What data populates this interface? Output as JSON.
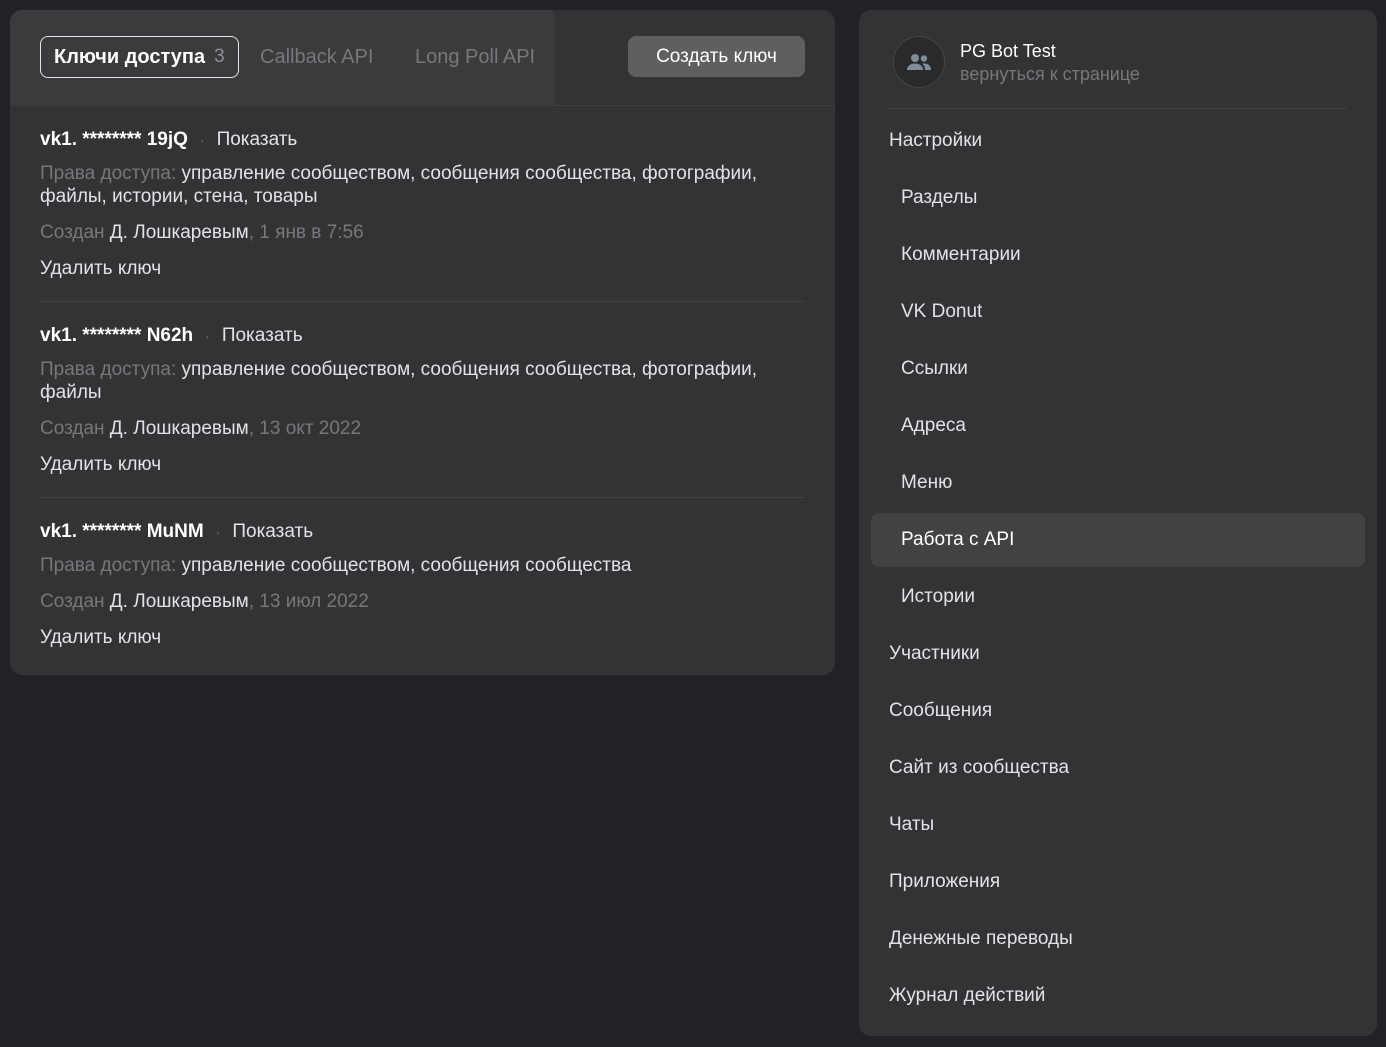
{
  "tabs": [
    {
      "label": "Ключи доступа",
      "count": "3"
    },
    {
      "label": "Callback API"
    },
    {
      "label": "Long Poll API"
    }
  ],
  "create_button": "Создать ключ",
  "keys": [
    {
      "name": "vk1. ******** 19jQ",
      "show": "Показать",
      "rights_label": "Права доступа:",
      "rights": "управление сообществом, сообщения сообщества, фотографии, файлы, истории, стена, товары",
      "created_label": "Создан",
      "author": "Д. Лошкаревым",
      "date": ", 1 янв в 7:56",
      "delete": "Удалить ключ"
    },
    {
      "name": "vk1. ******** N62h",
      "show": "Показать",
      "rights_label": "Права доступа:",
      "rights": "управление сообществом, сообщения сообщества, фотографии, файлы",
      "created_label": "Создан",
      "author": "Д. Лошкаревым",
      "date": ", 13 окт 2022",
      "delete": "Удалить ключ"
    },
    {
      "name": "vk1. ******** MuNM",
      "show": "Показать",
      "rights_label": "Права доступа:",
      "rights": "управление сообществом, сообщения сообщества",
      "created_label": "Создан",
      "author": "Д. Лошкаревым",
      "date": ", 13 июл 2022",
      "delete": "Удалить ключ"
    }
  ],
  "sidebar": {
    "group_name": "PG Bot Test",
    "back_link": "вернуться к странице",
    "avatar_icon": "users-icon",
    "items": [
      {
        "label": "Настройки",
        "sub": false
      },
      {
        "label": "Разделы",
        "sub": true
      },
      {
        "label": "Комментарии",
        "sub": true
      },
      {
        "label": "VK Donut",
        "sub": true
      },
      {
        "label": "Ссылки",
        "sub": true
      },
      {
        "label": "Адреса",
        "sub": true
      },
      {
        "label": "Меню",
        "sub": true
      },
      {
        "label": "Работа с API",
        "sub": true,
        "active": true
      },
      {
        "label": "Истории",
        "sub": true
      },
      {
        "label": "Участники",
        "sub": false
      },
      {
        "label": "Сообщения",
        "sub": false
      },
      {
        "label": "Сайт из сообщества",
        "sub": false
      },
      {
        "label": "Чаты",
        "sub": false
      },
      {
        "label": "Приложения",
        "sub": false
      },
      {
        "label": "Денежные переводы",
        "sub": false
      },
      {
        "label": "Журнал действий",
        "sub": false
      }
    ]
  }
}
